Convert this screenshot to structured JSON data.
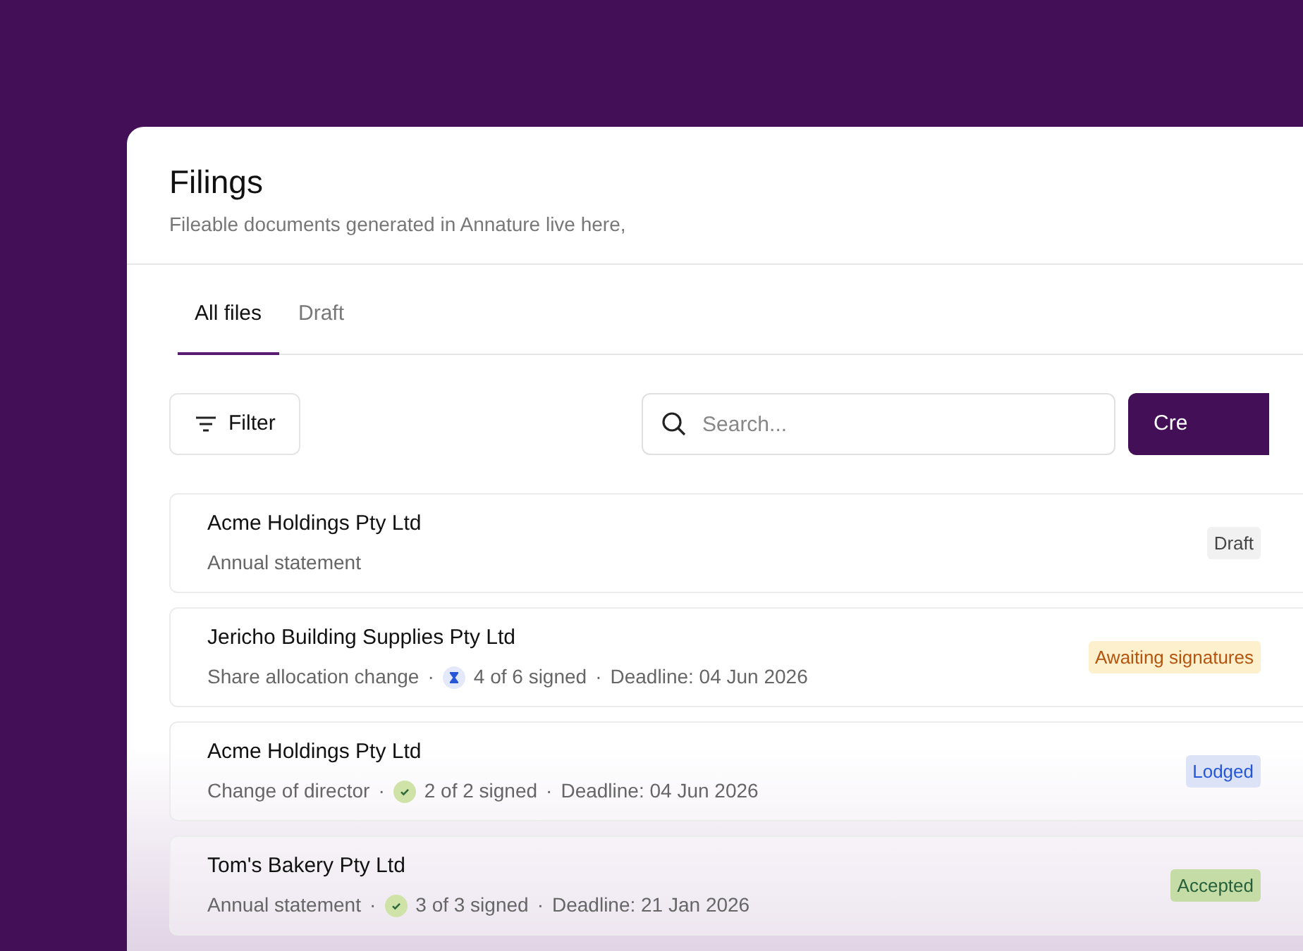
{
  "header": {
    "title": "Filings",
    "subtitle": "Fileable documents generated in Annature live here,"
  },
  "tabs": [
    {
      "label": "All files",
      "selected": true
    },
    {
      "label": "Draft",
      "selected": false
    }
  ],
  "toolbar": {
    "filter": "Filter",
    "search": {
      "placeholder": "Search..."
    },
    "create": "Cre"
  },
  "separator": "·",
  "filings": [
    {
      "company": "Acme Holdings Pty Ltd",
      "document": "Annual statement",
      "status": {
        "label": "Draft",
        "kind": "draft"
      }
    },
    {
      "company": "Jericho Building Supplies Pty Ltd",
      "document": "Share allocation change",
      "signatures": {
        "text": "4 of 6 signed",
        "kind": "pending"
      },
      "deadline": "Deadline: 04 Jun 2026",
      "status": {
        "label": "Awaiting signatures",
        "kind": "awaiting"
      }
    },
    {
      "company": "Acme Holdings Pty Ltd",
      "document": "Change of director",
      "signatures": {
        "text": "2 of 2 signed",
        "kind": "complete"
      },
      "deadline": "Deadline: 04 Jun 2026",
      "status": {
        "label": "Lodged",
        "kind": "lodged"
      }
    },
    {
      "company": "Tom's Bakery Pty Ltd",
      "document": "Annual statement",
      "signatures": {
        "text": "3 of 3 signed",
        "kind": "complete"
      },
      "deadline": "Deadline: 21 Jan 2026",
      "status": {
        "label": "Accepted",
        "kind": "accepted"
      }
    }
  ]
}
